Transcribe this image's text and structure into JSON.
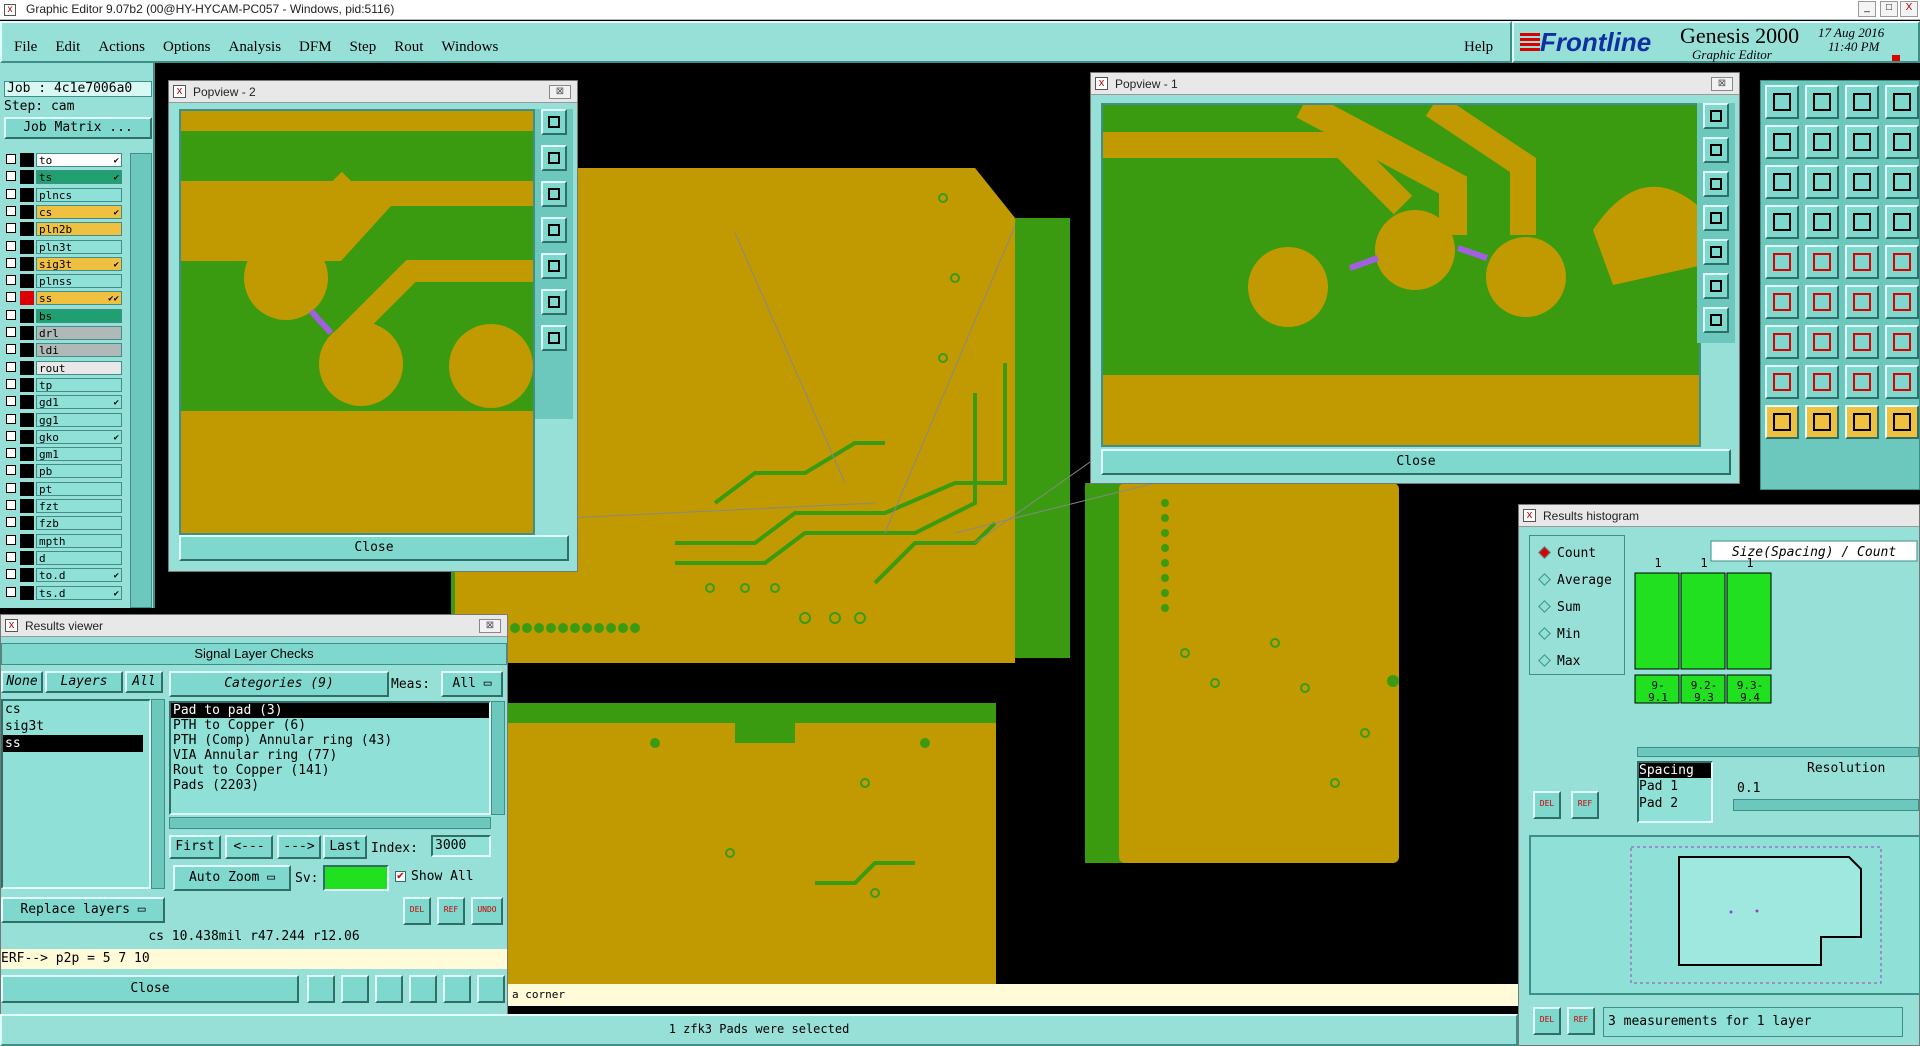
{
  "titlebar": {
    "text": "Graphic Editor 9.07b2 (00@HY-HYCAM-PC057 - Windows, pid:5116)",
    "btn_min": "_",
    "btn_max": "□",
    "btn_close": "X"
  },
  "menu": {
    "items": [
      "File",
      "Edit",
      "Actions",
      "Options",
      "Analysis",
      "DFM",
      "Step",
      "Rout",
      "Windows"
    ],
    "help": "Help"
  },
  "brand": {
    "logo": "Frontline",
    "product": "Genesis 2000",
    "subtitle": "Graphic Editor",
    "date": "17 Aug 2016",
    "time": "11:40 PM"
  },
  "job": {
    "job": "Job : 4c1e7006a0",
    "step": "Step: cam",
    "matrix_btn": "Job Matrix ..."
  },
  "layers": [
    {
      "name": "to",
      "bg": "#ffffff",
      "mark": "✔"
    },
    {
      "name": "ts",
      "bg": "#20a070",
      "mark": "✔"
    },
    {
      "name": "plncs",
      "bg": "#8fe0d6",
      "mark": ""
    },
    {
      "name": "cs",
      "bg": "#f0c040",
      "mark": "✔"
    },
    {
      "name": "pln2b",
      "bg": "#f0c040",
      "mark": ""
    },
    {
      "name": "pln3t",
      "bg": "#8fe0d6",
      "mark": ""
    },
    {
      "name": "sig3t",
      "bg": "#f0c040",
      "mark": "✔"
    },
    {
      "name": "plnss",
      "bg": "#8fe0d6",
      "mark": ""
    },
    {
      "name": "ss",
      "bg": "#f0c040",
      "mark": "✔✔"
    },
    {
      "name": "bs",
      "bg": "#20a070",
      "mark": ""
    },
    {
      "name": "drl",
      "bg": "#b0b8b8",
      "mark": ""
    },
    {
      "name": "ldi",
      "bg": "#b0b8b8",
      "mark": ""
    },
    {
      "name": "rout",
      "bg": "#e8e8e8",
      "mark": ""
    },
    {
      "name": "tp",
      "bg": "#8fe0d6",
      "mark": ""
    },
    {
      "name": "gd1",
      "bg": "#8fe0d6",
      "mark": "✔"
    },
    {
      "name": "gg1",
      "bg": "#8fe0d6",
      "mark": ""
    },
    {
      "name": "gko",
      "bg": "#8fe0d6",
      "mark": "✔"
    },
    {
      "name": "gm1",
      "bg": "#8fe0d6",
      "mark": ""
    },
    {
      "name": "pb",
      "bg": "#8fe0d6",
      "mark": ""
    },
    {
      "name": "pt",
      "bg": "#8fe0d6",
      "mark": ""
    },
    {
      "name": "fzt",
      "bg": "#8fe0d6",
      "mark": ""
    },
    {
      "name": "fzb",
      "bg": "#8fe0d6",
      "mark": ""
    },
    {
      "name": "mpth",
      "bg": "#8fe0d6",
      "mark": ""
    },
    {
      "name": "d",
      "bg": "#8fe0d6",
      "mark": ""
    },
    {
      "name": "to.d",
      "bg": "#8fe0d6",
      "mark": "✔"
    },
    {
      "name": "ts.d",
      "bg": "#8fe0d6",
      "mark": "✔"
    }
  ],
  "popview2": {
    "title": "Popview - 2",
    "close": "Close"
  },
  "popview1": {
    "title": "Popview - 1",
    "close": "Close"
  },
  "results_viewer": {
    "title": "Results viewer",
    "header": "Signal Layer Checks",
    "btn_none": "None",
    "btn_layers": "Layers",
    "btn_all": "All",
    "layer_list": [
      "cs",
      "sig3t",
      "ss"
    ],
    "categories_label": "Categories (9)",
    "meas_label": "Meas:",
    "meas_value": "All",
    "categories": [
      "Pad to pad (3)",
      "PTH to Copper (6)",
      "PTH (Comp) Annular ring (43)",
      "VIA Annular ring (77)",
      "Rout to Copper (141)",
      "Pads (2203)"
    ],
    "nav": [
      "First",
      "<---",
      "--->",
      "Last"
    ],
    "index_label": "Index:",
    "index_value": "3000",
    "auto_zoom": "Auto Zoom",
    "sv_label": "Sv:",
    "show_all": "Show All",
    "replace_layers": "Replace layers",
    "status": "cs 10.438mil   r47.244   r12.06",
    "erf": "ERF--> p2p = 5 7 10",
    "close": "Close",
    "del": "DEL",
    "ref": "REF",
    "undo": "UNDO"
  },
  "histogram": {
    "title": "Results histogram",
    "radios": [
      "Count",
      "Average",
      "Sum",
      "Min",
      "Max"
    ],
    "axis_title": "Size(Spacing) / Count",
    "spacing_list": [
      "Spacing",
      "Pad 1",
      "Pad 2"
    ],
    "resolution_label": "Resolution",
    "resolution_value": "0.1",
    "summary": "3 measurements for 1 layer",
    "del": "DEL",
    "ref": "REF",
    "bar_color": "#20e020"
  },
  "chart_data": {
    "type": "bar",
    "categories": [
      "9-9.1",
      "9.2-9.3",
      "9.3-9.4"
    ],
    "tick_labels": [
      "9-\n9.1",
      "9.2-\n9.3",
      "9.3-\n9.4"
    ],
    "values": [
      1,
      1,
      1
    ],
    "title": "Size(Spacing) / Count"
  },
  "status": {
    "prompt": "a corner",
    "selection": "1 zfk3 Pads were selected"
  },
  "colors": {
    "panel": "#97e0d8",
    "copper": "#c09a00",
    "substrate": "#3a9a10",
    "trace": "#b09000"
  }
}
